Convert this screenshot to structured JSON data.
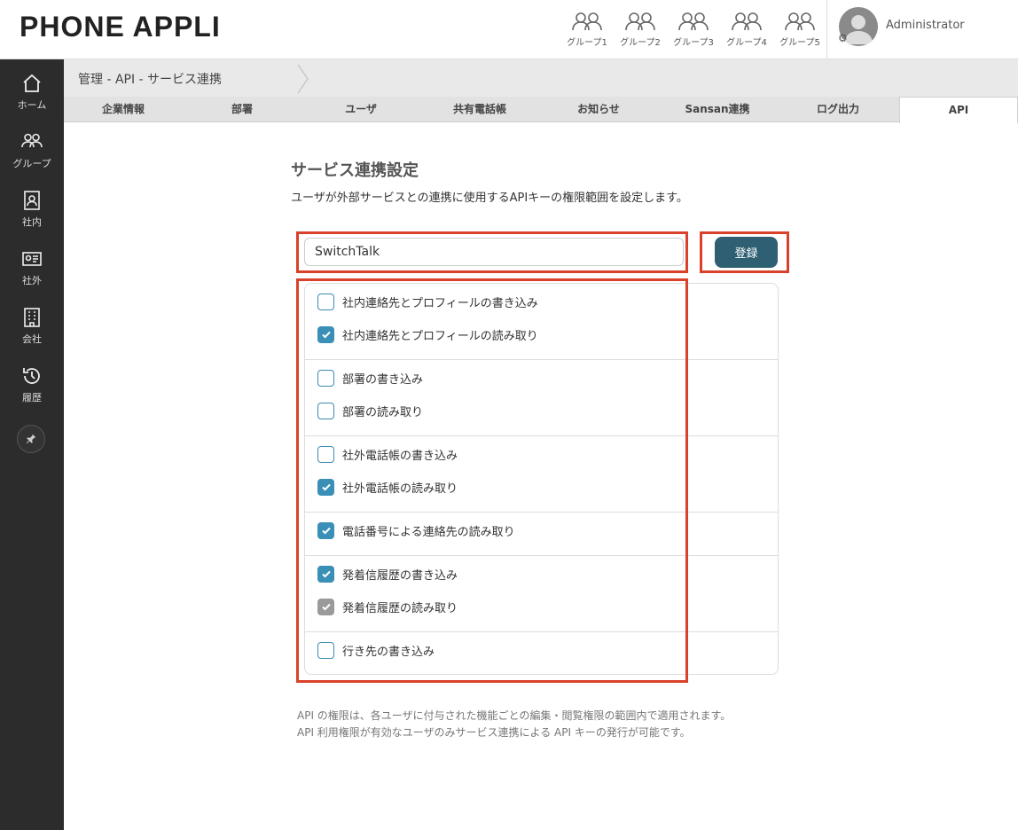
{
  "header": {
    "logo": "PHONE APPLI",
    "groups": [
      "グループ1",
      "グループ2",
      "グループ3",
      "グループ4",
      "グループ5"
    ],
    "user_name": "Administrator"
  },
  "sidebar": {
    "items": [
      {
        "label": "ホーム",
        "icon": "home-icon"
      },
      {
        "label": "グループ",
        "icon": "group-icon"
      },
      {
        "label": "社内",
        "icon": "contact-book-icon"
      },
      {
        "label": "社外",
        "icon": "id-card-icon"
      },
      {
        "label": "会社",
        "icon": "building-icon"
      },
      {
        "label": "履歴",
        "icon": "history-icon"
      }
    ],
    "pin_icon": "pin-icon"
  },
  "breadcrumb": "管理 - API - サービス連携",
  "tabs": [
    "企業情報",
    "部署",
    "ユーザ",
    "共有電話帳",
    "お知らせ",
    "Sansan連携",
    "ログ出力",
    "API"
  ],
  "active_tab": "API",
  "content": {
    "title": "サービス連携設定",
    "description": "ユーザが外部サービスとの連携に使用するAPIキーの権限範囲を設定します。",
    "service_name_value": "SwitchTalk",
    "register_label": "登録",
    "permissions": [
      {
        "label": "社内連絡先とプロフィールの書き込み",
        "state": "unchecked"
      },
      {
        "label": "社内連絡先とプロフィールの読み取り",
        "state": "checked"
      },
      {
        "label": "部署の書き込み",
        "state": "unchecked"
      },
      {
        "label": "部署の読み取り",
        "state": "unchecked"
      },
      {
        "label": "社外電話帳の書き込み",
        "state": "unchecked"
      },
      {
        "label": "社外電話帳の読み取り",
        "state": "checked"
      },
      {
        "label": "電話番号による連絡先の読み取り",
        "state": "checked"
      },
      {
        "label": "発着信履歴の書き込み",
        "state": "checked"
      },
      {
        "label": "発着信履歴の読み取り",
        "state": "checked-disabled"
      },
      {
        "label": "行き先の書き込み",
        "state": "unchecked"
      }
    ],
    "notes": [
      "API の権限は、各ユーザに付与された機能ごとの編集・閲覧権限の範囲内で適用されます。",
      "API 利用権限が有効なユーザのみサービス連携による API キーの発行が可能です。"
    ]
  },
  "colors": {
    "sidebar_bg": "#2c2c2c",
    "button": "#2e5f72",
    "checkbox": "#3a8fb7",
    "highlight": "#d9412a"
  }
}
